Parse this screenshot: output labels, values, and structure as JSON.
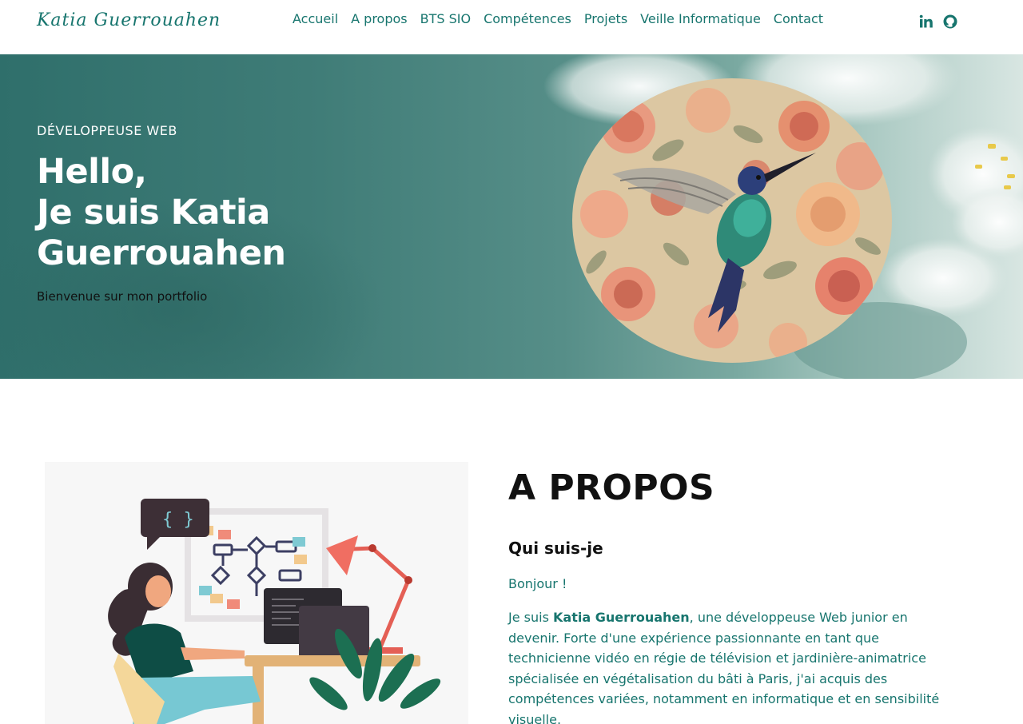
{
  "brand": "Katia Guerrouahen",
  "nav": {
    "items": [
      "Accueil",
      "A propos",
      "BTS SIO",
      "Compétences",
      "Projets",
      "Veille Informatique",
      "Contact"
    ]
  },
  "social": {
    "icons": [
      "linkedin-icon",
      "github-icon"
    ]
  },
  "hero": {
    "subtitle": "DÉVELOPPEUSE WEB",
    "title_line1": "Hello,",
    "title_line2": "Je suis Katia",
    "title_line3": "Guerrouahen",
    "welcome": "Bienvenue sur mon portfolio"
  },
  "about": {
    "title": "A PROPOS",
    "subtitle": "Qui suis-je",
    "greeting": "Bonjour !",
    "text_prefix": "Je suis ",
    "text_name": "Katia Guerrouahen",
    "text_rest": ", une développeuse Web junior en devenir. Forte d'une expérience passionnante en tant que technicienne vidéo en régie de télévision et jardinière-animatrice spécialisée en végétalisation du bâti à Paris, j'ai acquis des compétences variées, notamment en informatique et en sensibilité visuelle."
  },
  "colors": {
    "accent": "#17756e",
    "hero_dark": "#2f6f6b"
  }
}
